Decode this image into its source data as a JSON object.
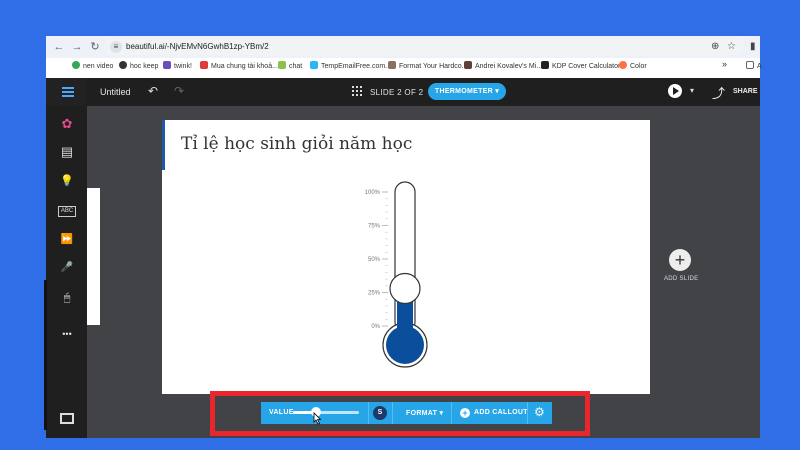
{
  "browser": {
    "url": "beautiful.ai/-NjvEMvN6GwhB1zp-YBm/2",
    "nav": {
      "back": "←",
      "forward": "→",
      "reload": "↻"
    },
    "right_icons": {
      "zoom": "⊕",
      "star": "☆",
      "tabstrip": "▮"
    },
    "bookmarks": [
      {
        "label": "nen video",
        "color": "#34a853"
      },
      {
        "label": "hoc keep",
        "color": "#333333"
      },
      {
        "label": "twink!",
        "color": "#6b4fbb"
      },
      {
        "label": "Mua chung tài khoả...",
        "color": "#e53935"
      },
      {
        "label": "chat",
        "color": "#8bc34a"
      },
      {
        "label": "TempEmailFree.com...",
        "color": "#29b6f6"
      },
      {
        "label": "Format Your Hardco...",
        "color": "#8d6e63"
      },
      {
        "label": "Andrei Kovalev's Mi...",
        "color": "#5d4037"
      },
      {
        "label": "KDP Cover Calculator",
        "color": "#222222"
      },
      {
        "label": "Color",
        "color": "#ff7043"
      }
    ],
    "more_bookmarks": "»",
    "other_bookmarks": "A"
  },
  "app": {
    "doc_title": "Untitled",
    "undo_icon": "↶",
    "redo_icon": "↷",
    "slide_counter": "SLIDE 2 OF 2",
    "slide_type": "THERMOMETER ▾",
    "play_caret": "▾",
    "share_icon": "⤴",
    "share_label": "SHARE"
  },
  "sidebar": {
    "items": [
      {
        "name": "theme-icon",
        "glyph": "✿"
      },
      {
        "name": "layout-icon",
        "glyph": "▤"
      },
      {
        "name": "lightbulb-icon",
        "glyph": "💡"
      },
      {
        "name": "abc-icon",
        "glyph": "ABC"
      },
      {
        "name": "fast-forward-icon",
        "glyph": "⏩"
      },
      {
        "name": "microphone-icon",
        "glyph": "🎤"
      },
      {
        "name": "mouse-icon",
        "glyph": "🖱"
      },
      {
        "name": "more-icon",
        "glyph": "•••"
      }
    ]
  },
  "slide": {
    "title": "Tỉ lệ học sinh giỏi năm học",
    "thermometer": {
      "value_percent": 25,
      "ticks": [
        "100%",
        "75%",
        "50%",
        "25%",
        "0%"
      ],
      "fill_color": "#0b4f9c"
    }
  },
  "add_slide": {
    "icon": "+",
    "label": "ADD SLIDE"
  },
  "toolbar": {
    "value_label": "VALUE",
    "slider_value": 0.35,
    "s_badge": "S",
    "format_label": "FORMAT ▾",
    "callout_icon": "+",
    "callout_label": "ADD CALLOUT",
    "gear_icon": "⚙"
  },
  "colors": {
    "accent": "#26a6e8",
    "highlight_frame": "#e8262c",
    "background": "#2f6ee6"
  }
}
